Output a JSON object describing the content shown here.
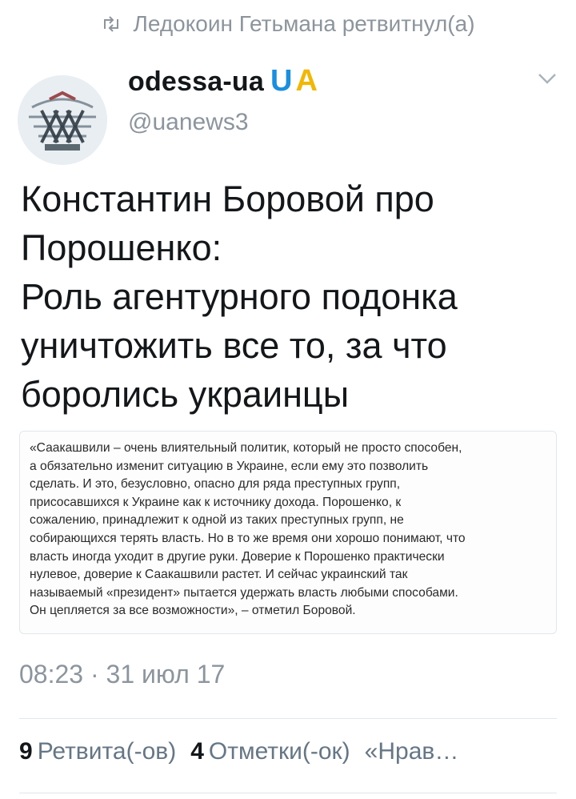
{
  "retweet": {
    "icon": "retweet-icon",
    "text": "Ледокоин Гетьмана ретвитнул(а)"
  },
  "author": {
    "display_name": "odessa-ua",
    "flag_u": "U",
    "flag_a": "A",
    "handle": "@uanews3",
    "avatar_icon": "avatar-graphic"
  },
  "tweet": {
    "line1": "Константин Боровой про",
    "line2": "Порошенко:",
    "line3": "Роль агентурного подонка",
    "line4": "уничтожить все то, за что",
    "line5": "боролись украинцы"
  },
  "quote": {
    "lines": [
      "«Саакашвили – очень влиятельный политик, который не просто способен,",
      "а обязательно изменит ситуацию в Украине, если ему это позволить",
      "сделать. И это, безусловно, опасно для ряда преступных групп,",
      "присосавшихся к Украине как к источнику дохода. Порошенко, к",
      "сожалению, принадлежит к одной из таких преступных групп, не",
      "собирающихся терять власть. Но в то же время они хорошо понимают, что",
      "власть иногда уходит в другие руки. Доверие к Порошенко практически",
      "нулевое, доверие к Саакашвили растет. И сейчас украинский так",
      "называемый «президент» пытается удержать власть любыми способами.",
      "Он цепляется за все возможности», – отметил Боровой."
    ]
  },
  "timestamp": "08:23 · 31 июл 17",
  "stats": {
    "retweets_count": "9",
    "retweets_label": "Ретвита(-ов)",
    "likes_count": "4",
    "likes_label": "Отметки(-ок)",
    "more_label": "«Нрав…"
  },
  "colors": {
    "accent_blue": "#1a8fe0",
    "accent_yellow": "#f2b705",
    "muted": "#8c959d"
  }
}
